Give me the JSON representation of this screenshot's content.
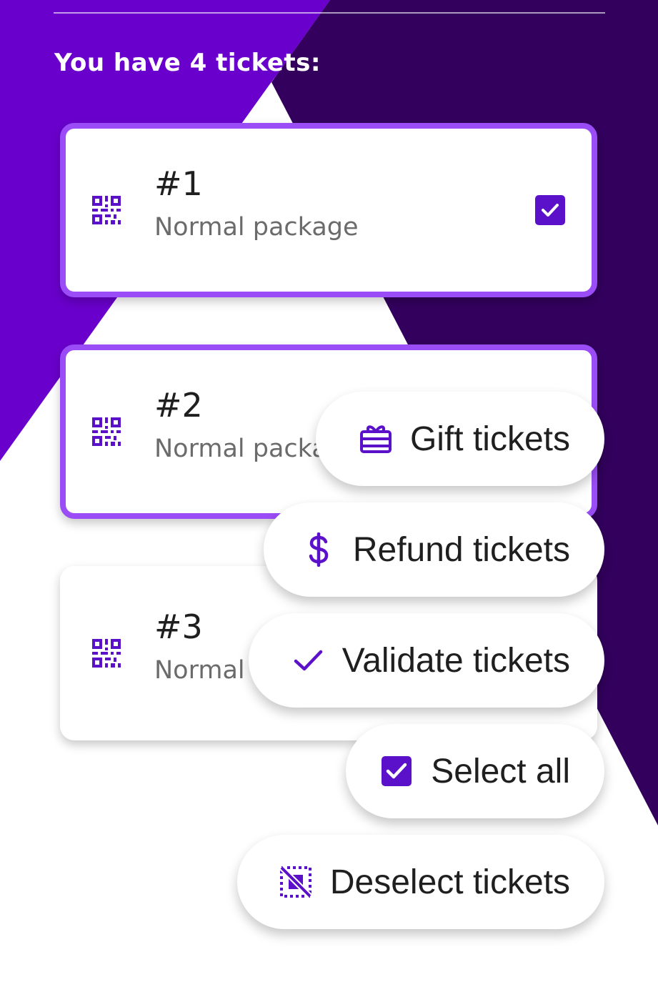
{
  "colors": {
    "primary_purple": "#6A00CC",
    "dark_purple": "#33005E",
    "card_border": "#9A4DF6",
    "icon_purple": "#5B10C9"
  },
  "heading": "You have 4 tickets:",
  "tickets": [
    {
      "number": "#1",
      "package": "Normal package",
      "icon": "qr-code-icon",
      "selected": true
    },
    {
      "number": "#2",
      "package": "Normal package",
      "icon": "qr-code-icon",
      "selected": true
    },
    {
      "number": "#3",
      "package": "Normal package",
      "icon": "qr-code-icon",
      "selected": false
    }
  ],
  "actions": [
    {
      "label": "Gift tickets",
      "icon": "gift-card-icon"
    },
    {
      "label": "Refund tickets",
      "icon": "dollar-icon"
    },
    {
      "label": "Validate tickets",
      "icon": "check-icon"
    },
    {
      "label": "Select all",
      "icon": "checkbox-checked-icon"
    },
    {
      "label": "Deselect tickets",
      "icon": "deselect-icon"
    }
  ]
}
